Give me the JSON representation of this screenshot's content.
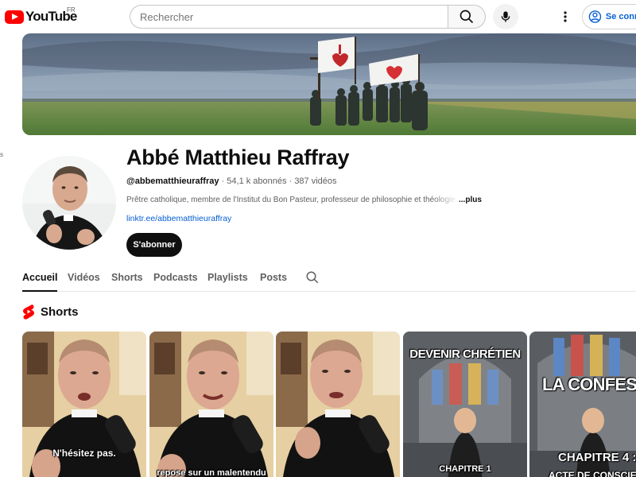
{
  "header": {
    "logo_text": "YouTube",
    "region": "FR",
    "search_placeholder": "Rechercher",
    "search_icon": "search-icon",
    "mic_icon": "microphone-icon",
    "more_icon": "more-vert-icon",
    "signin_label": "Se connecter",
    "brand_color": "#ff0000",
    "link_color": "#065fd4"
  },
  "channel": {
    "name": "Abbé Matthieu Raffray",
    "handle": "@abbematthieuraffray",
    "subscribers": "54,1 k abonnés",
    "videos": "387 vidéos",
    "separator": "·",
    "description": "Prêtre catholique, membre de l'Institut du Bon Pasteur, professeur de philosophie et théologie",
    "more_label": "...plus",
    "link": "linktr.ee/abbematthieuraffray",
    "subscribe_label": "S'abonner"
  },
  "tabs": [
    {
      "label": "Accueil",
      "active": true
    },
    {
      "label": "Vidéos",
      "active": false
    },
    {
      "label": "Shorts",
      "active": false
    },
    {
      "label": "Podcasts",
      "active": false
    },
    {
      "label": "Playlists",
      "active": false
    },
    {
      "label": "Posts",
      "active": false
    }
  ],
  "shorts_section": {
    "title": "Shorts",
    "icon": "shorts-icon",
    "items": [
      {
        "caption": "N'hésitez pas."
      },
      {
        "caption": "repose sur un malentendu"
      },
      {
        "caption": ""
      },
      {
        "title_line": "DEVENIR CHRÉTIEN",
        "caption": "CHAPITRE 1"
      },
      {
        "title_line": "LA CONFESSION",
        "caption": "CHAPITRE 4 :",
        "caption2": "ACTE DE CONSCIENCE"
      }
    ]
  }
}
